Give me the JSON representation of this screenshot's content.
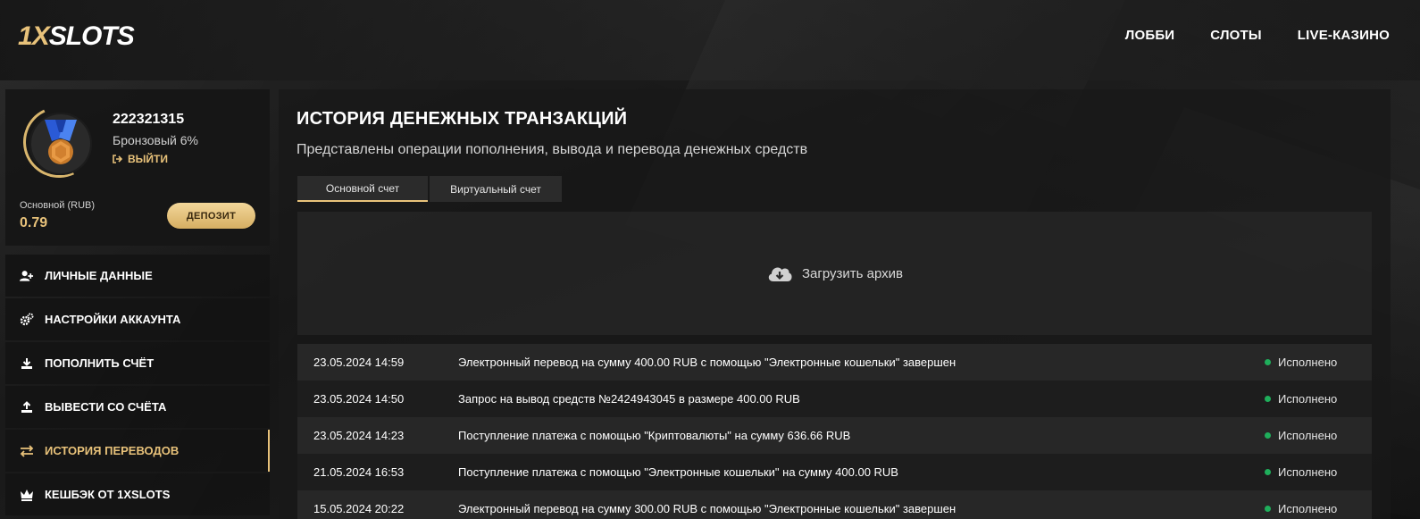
{
  "header": {
    "logo": {
      "one": "1",
      "x": "X",
      "rest": "SLOTS"
    },
    "nav": [
      "ЛОББИ",
      "СЛОТЫ",
      "LIVE-КАЗИНО"
    ]
  },
  "profile": {
    "user_id": "222321315",
    "tier": "Бронзовый 6%",
    "logout": "ВЫЙТИ",
    "balance_label": "Основной (RUB)",
    "balance_value": "0.79",
    "deposit_button": "ДЕПОЗИТ"
  },
  "menu": {
    "items": [
      {
        "label": "ЛИЧНЫЕ ДАННЫЕ",
        "icon": "user-plus-icon"
      },
      {
        "label": "НАСТРОЙКИ АККАУНТА",
        "icon": "gears-icon"
      },
      {
        "label": "ПОПОЛНИТЬ СЧЁТ",
        "icon": "download-icon"
      },
      {
        "label": "ВЫВЕСТИ СО СЧЁТА",
        "icon": "upload-icon"
      },
      {
        "label": "ИСТОРИЯ ПЕРЕВОДОВ",
        "icon": "transfer-arrows-icon",
        "active": true
      },
      {
        "label": "КЕШБЭК ОТ 1XSLOTS",
        "icon": "crown-icon"
      }
    ]
  },
  "main": {
    "title": "ИСТОРИЯ ДЕНЕЖНЫХ ТРАНЗАКЦИЙ",
    "subtitle": "Представлены операции пополнения, вывода и перевода денежных средств",
    "tabs": [
      "Основной счет",
      "Виртуальный счет"
    ],
    "archive_label": "Загрузить архив",
    "transactions": [
      {
        "date": "23.05.2024 14:59",
        "description": "Электронный перевод на сумму 400.00 RUB с помощью \"Электронные кошельки\" завершен",
        "status": "Исполнено"
      },
      {
        "date": "23.05.2024 14:50",
        "description": "Запрос на вывод средств №2424943045 в размере 400.00 RUB",
        "status": "Исполнено"
      },
      {
        "date": "23.05.2024 14:23",
        "description": "Поступление платежа с помощью \"Криптовалюты\" на сумму 636.66 RUB",
        "status": "Исполнено"
      },
      {
        "date": "21.05.2024 16:53",
        "description": "Поступление платежа с помощью \"Электронные кошельки\" на сумму 400.00 RUB",
        "status": "Исполнено"
      },
      {
        "date": "15.05.2024 20:22",
        "description": "Электронный перевод на сумму 300.00 RUB с помощью \"Электронные кошельки\" завершен",
        "status": "Исполнено"
      }
    ]
  },
  "colors": {
    "accent": "#e8c27a",
    "status_ok": "#1fae5b"
  }
}
